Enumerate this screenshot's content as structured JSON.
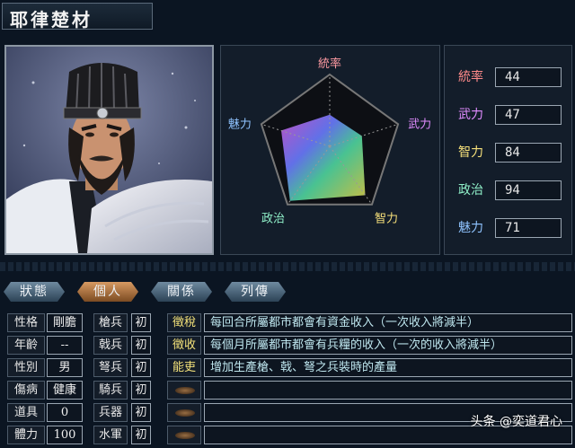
{
  "officer_name": "耶律楚材",
  "radar": {
    "labels": {
      "lead": "統率",
      "war": "武力",
      "int": "智力",
      "pol": "政治",
      "chr": "魅力"
    },
    "values": {
      "lead": 44,
      "war": 47,
      "int": 84,
      "pol": 94,
      "chr": 71
    },
    "max": 100
  },
  "stats": [
    {
      "label": "統率",
      "value": "44",
      "color": "#ff8a8a"
    },
    {
      "label": "武力",
      "value": "47",
      "color": "#e08cff"
    },
    {
      "label": "智力",
      "value": "84",
      "color": "#f6e07a"
    },
    {
      "label": "政治",
      "value": "94",
      "color": "#8fefc8"
    },
    {
      "label": "魅力",
      "value": "71",
      "color": "#8fc3ff"
    }
  ],
  "tabs": [
    "狀態",
    "個人",
    "關係",
    "列傳"
  ],
  "active_tab": 1,
  "profile": [
    {
      "label": "性格",
      "value": "剛膽"
    },
    {
      "label": "年齡",
      "value": "--"
    },
    {
      "label": "性別",
      "value": "男"
    },
    {
      "label": "傷病",
      "value": "健康"
    },
    {
      "label": "道具",
      "value": "0"
    },
    {
      "label": "體力",
      "value": "100"
    }
  ],
  "troops": [
    {
      "label": "槍兵",
      "value": "初"
    },
    {
      "label": "戟兵",
      "value": "初"
    },
    {
      "label": "弩兵",
      "value": "初"
    },
    {
      "label": "騎兵",
      "value": "初"
    },
    {
      "label": "兵器",
      "value": "初"
    },
    {
      "label": "水軍",
      "value": "初"
    }
  ],
  "skills": [
    {
      "name": "徵稅",
      "desc": "每回合所屬都市都會有資金收入（一次收入將減半）"
    },
    {
      "name": "徵收",
      "desc": "每個月所屬都市都會有兵糧的收入（一次的收入將減半）"
    },
    {
      "name": "能吏",
      "desc": "增加生產槍、戟、弩之兵裝時的產量"
    },
    {
      "name": "",
      "desc": ""
    },
    {
      "name": "",
      "desc": ""
    },
    {
      "name": "",
      "desc": ""
    }
  ],
  "watermark": "头条 @奕道君心",
  "colors": {
    "accent_tab": "#d79a62",
    "tab": "#4f6a80",
    "skill_name": "#f4e27a",
    "skill_desc": "#bfe7ef"
  }
}
